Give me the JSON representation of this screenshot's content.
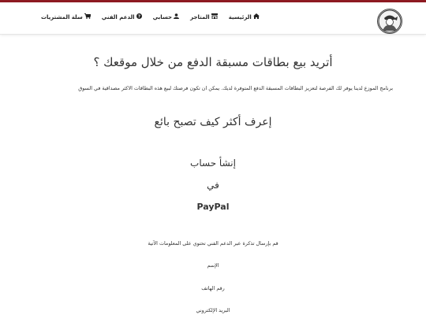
{
  "nav": {
    "home": {
      "label": "الرئيسية",
      "icon": "home-icon"
    },
    "stores": {
      "label": "المتاجر",
      "icon": "store-icon"
    },
    "account": {
      "label": "حسابي",
      "icon": "user-icon"
    },
    "support": {
      "label": "الدعم الفني",
      "icon": "question-circle-icon"
    },
    "cart": {
      "label": "سلة المشتريات",
      "icon": "cart-icon"
    }
  },
  "main": {
    "heading": "أتريد بيع بطاقات مسبقة الدفع من خلال موقعك ؟",
    "intro": "برنامج الموزع لدينا يوفر لك الفرصة لتعزيز البطاقات المسبقة الدفع المتوفرة لديك. يمكن ان تكون فرصتك لبيع هذه البطاقات الاكثر مصداقية في السوق",
    "learn_heading": "إعرف أكثر كيف تصبح بائع",
    "create_account": "إنشأ حساب",
    "in": "في",
    "paypal": "PayPal",
    "ticket_text": "قم بإرسال تذكرة عبر الدعم الفني تحتوي على المعلومات الآتية",
    "field_name": "الإسم",
    "field_phone": "رقم الهاتف",
    "field_email": "البريد الإلكتروني"
  },
  "colors": {
    "accent": "#8e1b22"
  }
}
